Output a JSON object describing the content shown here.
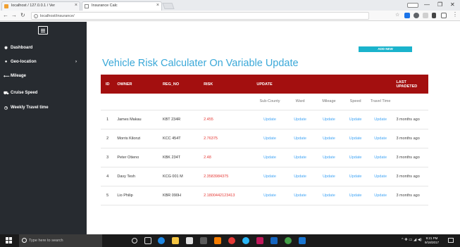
{
  "browser": {
    "tabs": [
      {
        "title": "localhost / 127.0.0.1 / Ver"
      },
      {
        "title": "Insurance Calc"
      }
    ],
    "url": "localhost/insurance/"
  },
  "sidebar": {
    "items": [
      {
        "label": "Dashboard",
        "icon": "dashboard-icon"
      },
      {
        "label": "Geo-location",
        "icon": "map-marker-icon",
        "has_children": true
      },
      {
        "label": "Mileage",
        "icon": "arrow-icon"
      },
      {
        "label": "Cruise Speed",
        "icon": "car-icon"
      },
      {
        "label": "Weekly Travel time",
        "icon": "clock-icon"
      }
    ]
  },
  "main": {
    "add_new_label": "ADD NEW",
    "title": "Vehicle Risk Calculater On Variable Update",
    "table": {
      "headers": [
        "ID",
        "OWNER",
        "REG_NO",
        "RISK",
        "UPDATE",
        "LAST UPADETED"
      ],
      "update_subheaders": [
        "Sub-County",
        "Ward",
        "Mileage",
        "Speed",
        "Travel Time"
      ],
      "rows": [
        {
          "id": "1",
          "owner": "James Makau",
          "reg_no": "KBT 234R",
          "risk": "2.455",
          "last_updated": "3 months ago"
        },
        {
          "id": "2",
          "owner": "Morris Kilonzi",
          "reg_no": "KCC 454T",
          "risk": "2.76375",
          "last_updated": "3 months ago"
        },
        {
          "id": "3",
          "owner": "Peter Otieno",
          "reg_no": "KBK 234T",
          "risk": "2.48",
          "last_updated": "3 months ago"
        },
        {
          "id": "4",
          "owner": "Davy Tesh",
          "reg_no": "KCG 001 M",
          "risk": "2.3583984375",
          "last_updated": "3 months ago"
        },
        {
          "id": "5",
          "owner": "Lio Philip",
          "reg_no": "KBR 090H",
          "risk": "2.1800442123413",
          "last_updated": "3 months ago"
        }
      ],
      "update_label": "Update"
    }
  },
  "taskbar": {
    "search_placeholder": "Type here to search",
    "time": "9:21 PM",
    "date": "9/18/2017"
  },
  "colors": {
    "sidebar_bg": "#272b30",
    "header_bg": "#a30f0f",
    "title": "#3aa8d8",
    "add_new": "#1ab3cc",
    "risk": "#e53935",
    "update_link": "#42a5f5"
  }
}
